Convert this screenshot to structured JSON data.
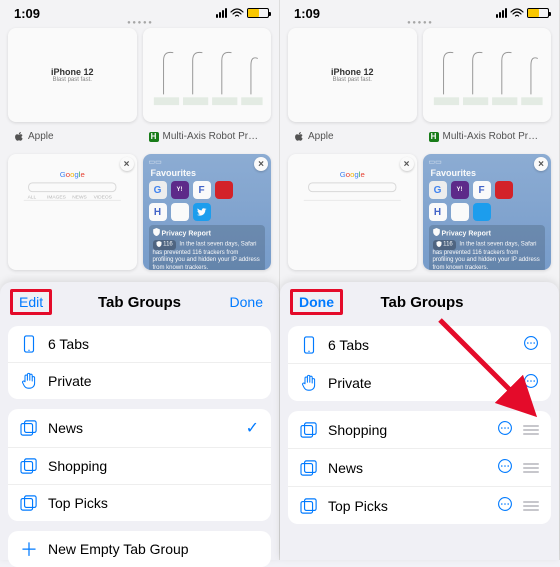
{
  "status": {
    "time": "1:09"
  },
  "thumbs": {
    "apple": {
      "title": "iPhone 12",
      "label": "Apple"
    },
    "robot": {
      "label": "Multi-Axis Robot Product..."
    },
    "google": {
      "label": "Google"
    },
    "favorites": {
      "title": "Favourites",
      "privacy_title": "Privacy Report",
      "privacy_text": "In the last seven days, Safari has prevented 116 trackers from profiling you and hidden your IP address from known trackers.",
      "tracker_count": "116"
    }
  },
  "sheet": {
    "title": "Tab Groups",
    "edit": "Edit",
    "done": "Done",
    "tabs_count_label": "6 Tabs",
    "private_label": "Private",
    "new_group_label": "New Empty Tab Group",
    "groups_left": [
      "News",
      "Shopping",
      "Top Picks"
    ],
    "groups_right": [
      "Shopping",
      "News",
      "Top Picks"
    ],
    "selected_left": "News"
  }
}
